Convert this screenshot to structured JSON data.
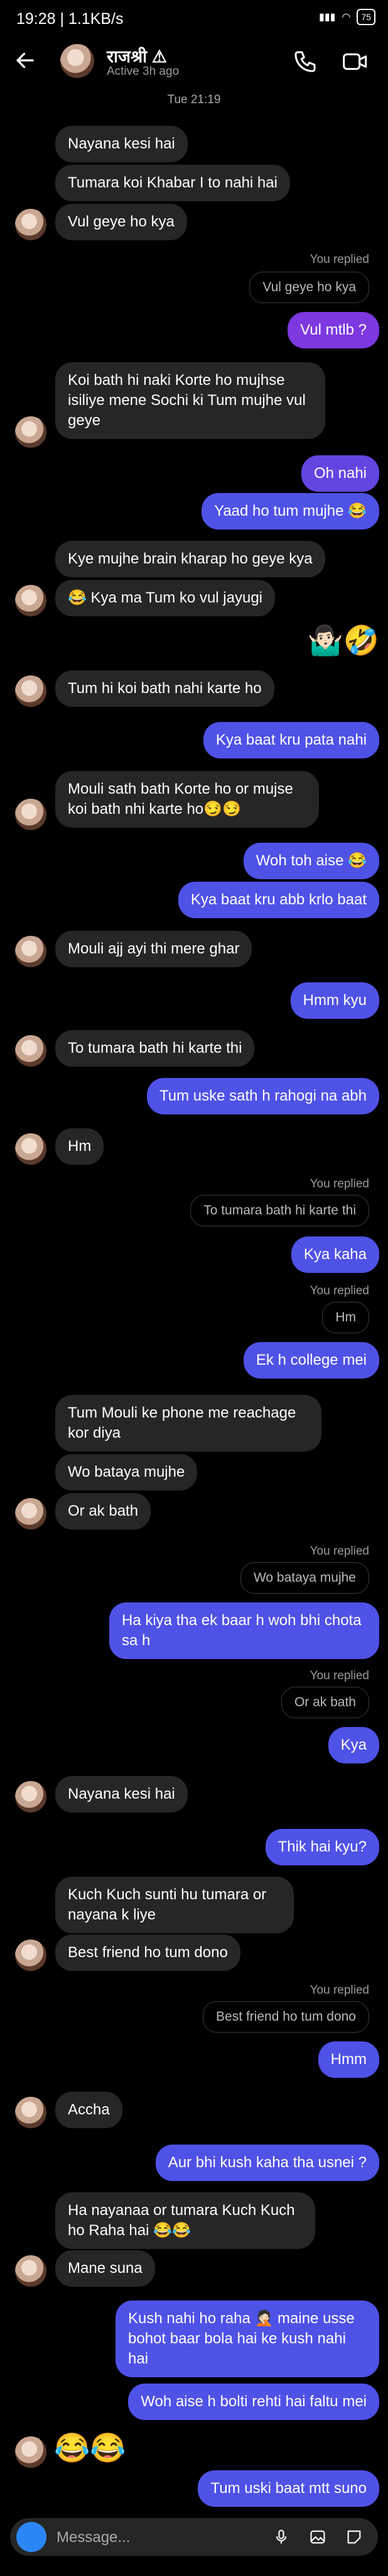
{
  "status_bar": {
    "time": "19:28 | 1.1KB/s",
    "battery": "75"
  },
  "header": {
    "name": "राजश्री",
    "status": "Active 3h ago"
  },
  "date": "Tue 21:19",
  "messages": {
    "m1": "Nayana kesi hai",
    "m2": "Tumara koi Khabar I to nahi hai",
    "m3": "Vul geye ho kya",
    "r1": "You replied",
    "q1": "Vul geye ho kya",
    "m4": "Vul mtlb ?",
    "m5": "Koi bath hi naki Korte ho mujhse isiliye mene Sochi ki Tum mujhe vul geye",
    "m6": "Oh nahi",
    "m7": "Yaad ho tum mujhe 😂",
    "m8": "Kye mujhe brain kharap ho geye kya",
    "m9": "😂 Kya ma Tum ko vul jayugi",
    "m10": "🤷🏻‍♂️🤣",
    "m11": "Tum hi koi bath nahi karte ho",
    "m12": "Kya baat kru pata nahi",
    "m13": "Mouli sath bath Korte ho or mujse koi bath nhi karte ho😏😏",
    "m14": "Woh toh aise 😂",
    "m15": "Kya baat kru abb krlo baat",
    "m16": "Mouli ajj ayi thi mere ghar",
    "m17": "Hmm kyu",
    "m18": "To tumara bath hi karte thi",
    "m19": "Tum uske sath h rahogi na abh",
    "m20": "Hm",
    "r2": "You replied",
    "q2": "To tumara bath hi karte thi",
    "m21": "Kya kaha",
    "r3": "You replied",
    "q3": "Hm",
    "m22": "Ek h college mei",
    "m23": "Tum Mouli ke phone me reachage kor diya",
    "m24": "Wo bataya mujhe",
    "m25": "Or ak bath",
    "r4": "You replied",
    "q4": "Wo bataya mujhe",
    "m26": "Ha kiya tha ek baar h woh bhi chota sa h",
    "r5": "You replied",
    "q5": "Or ak bath",
    "m27": "Kya",
    "m28": "Nayana kesi hai",
    "m29": "Thik hai kyu?",
    "m30": "Kuch Kuch sunti hu tumara or nayana k liye",
    "m31": "Best friend ho tum dono",
    "r6": "You replied",
    "q6": "Best friend ho tum dono",
    "m32": "Hmm",
    "m33": "Accha",
    "m34": "Aur bhi kush kaha tha usnei ?",
    "m35": "Ha nayanaa or tumara Kuch Kuch ho Raha hai 😂😂",
    "m36": "Mane suna",
    "m37": "Kush nahi ho raha 🤦🏻 maine usse bohot baar bola hai ke kush nahi hai",
    "m38": "Woh aise h bolti rehti hai faltu mei",
    "m39": "😂😂",
    "m40": "Tum uski baat mtt suno"
  },
  "composer": {
    "placeholder": "Message..."
  }
}
